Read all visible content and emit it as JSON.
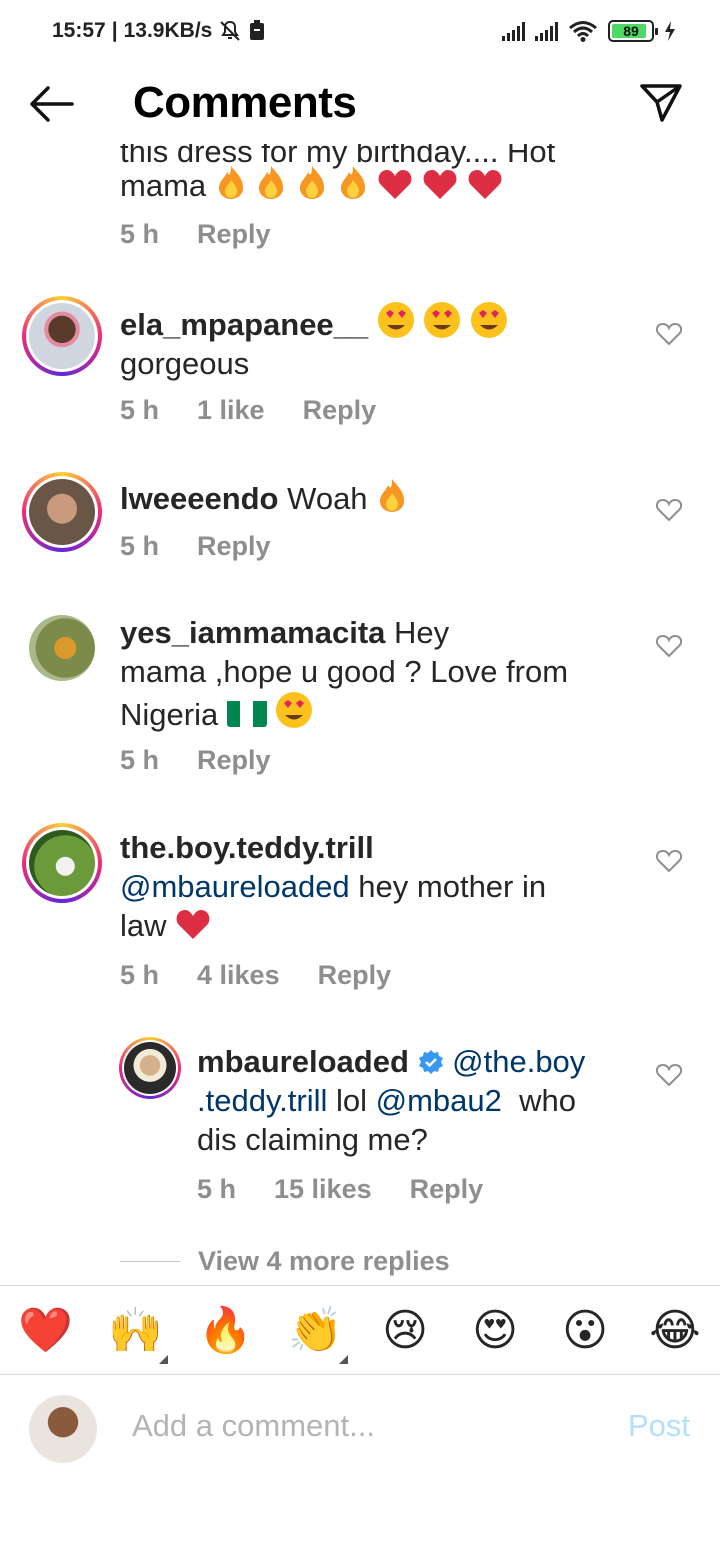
{
  "status_bar": {
    "time": "15:57",
    "net_speed": "13.9KB/s",
    "battery": "89"
  },
  "header": {
    "title": "Comments"
  },
  "comments": [
    {
      "cut_text": "this dress for my birthday.... Hot",
      "text": "mama",
      "time": "5 h",
      "reply": "Reply"
    },
    {
      "username": "ela_mpapanee__",
      "text": "gorgeous",
      "time": "5 h",
      "likes": "1 like",
      "reply": "Reply"
    },
    {
      "username": "lweeeendo",
      "text": "Woah",
      "time": "5 h",
      "reply": "Reply"
    },
    {
      "username": "yes_iammamacita",
      "text_line1": "Hey",
      "text_line2": "mama ,hope u good ? Love from",
      "text_line3": "Nigeria",
      "time": "5 h",
      "reply": "Reply"
    },
    {
      "username": "the.boy.teddy.trill",
      "mention": "@mbaureloaded",
      "text_line1": "hey mother in",
      "text_line2": "law",
      "time": "5 h",
      "likes": "4 likes",
      "reply": "Reply"
    },
    {
      "username": "mbaureloaded",
      "mention1a": "@the.boy",
      "mention1b": ".teddy.trill",
      "text_a": "lol",
      "mention2": "@mbau2",
      "text_b": "who",
      "text_line3": "dis claiming me?",
      "time": "5 h",
      "likes": "15 likes",
      "reply": "Reply"
    }
  ],
  "view_more": "View 4 more replies",
  "emoji_bar": [
    "❤️",
    "🙌",
    "🔥",
    "👏",
    "😢",
    "😍",
    "😮",
    "😂"
  ],
  "composer": {
    "placeholder": "Add a comment...",
    "post": "Post"
  },
  "colors": {
    "mention": "#00376b",
    "meta": "#8e8e8e",
    "post_disabled": "#b2dffc"
  }
}
